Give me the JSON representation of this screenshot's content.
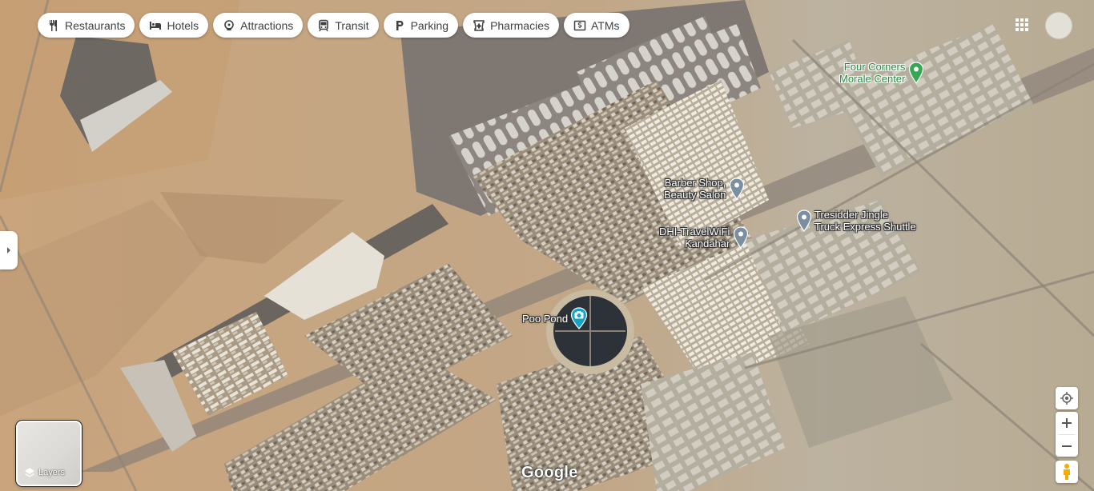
{
  "categories": [
    {
      "label": "Restaurants",
      "icon": "restaurant-icon"
    },
    {
      "label": "Hotels",
      "icon": "hotel-icon"
    },
    {
      "label": "Attractions",
      "icon": "attractions-icon"
    },
    {
      "label": "Transit",
      "icon": "transit-icon"
    },
    {
      "label": "Parking",
      "icon": "parking-icon"
    },
    {
      "label": "Pharmacies",
      "icon": "pharmacy-icon"
    },
    {
      "label": "ATMs",
      "icon": "atm-icon"
    }
  ],
  "places": [
    {
      "name": "four-corners-morale-center",
      "line1": "Four Corners",
      "line2": "Morale Center",
      "pin": "green-place-pin-icon",
      "pin_color": "#34a853"
    },
    {
      "name": "barber-shop-beauty-salon",
      "line1": "Barber Shop,",
      "line2": "Beauty Salon",
      "pin": "grey-place-pin-icon",
      "pin_color": "#7b8fa1"
    },
    {
      "name": "dhi-travelwifi-kandahar",
      "line1": "DHI-TravelWiFi",
      "line2": "Kandahar",
      "pin": "grey-place-pin-icon",
      "pin_color": "#7b8fa1"
    },
    {
      "name": "tresidder-jingle-truck-express-shuttle",
      "line1": "Tresidder Jingle",
      "line2": "Truck Express Shuttle",
      "pin": "grey-place-pin-icon",
      "pin_color": "#7b8fa1"
    },
    {
      "name": "poo-pond",
      "line1": "Poo Pond",
      "line2": "",
      "pin": "camera-pin-icon",
      "pin_color": "#12a4c4"
    }
  ],
  "controls": {
    "layers_label": "Layers",
    "apps_icon": "apps-grid-icon",
    "my_location_icon": "my-location-icon",
    "zoom_in_icon": "zoom-in-icon",
    "zoom_out_icon": "zoom-out-icon",
    "pegman_icon": "pegman-icon",
    "side_panel_icon": "chevron-right-icon"
  },
  "logo": "Google",
  "map_type": "satellite"
}
